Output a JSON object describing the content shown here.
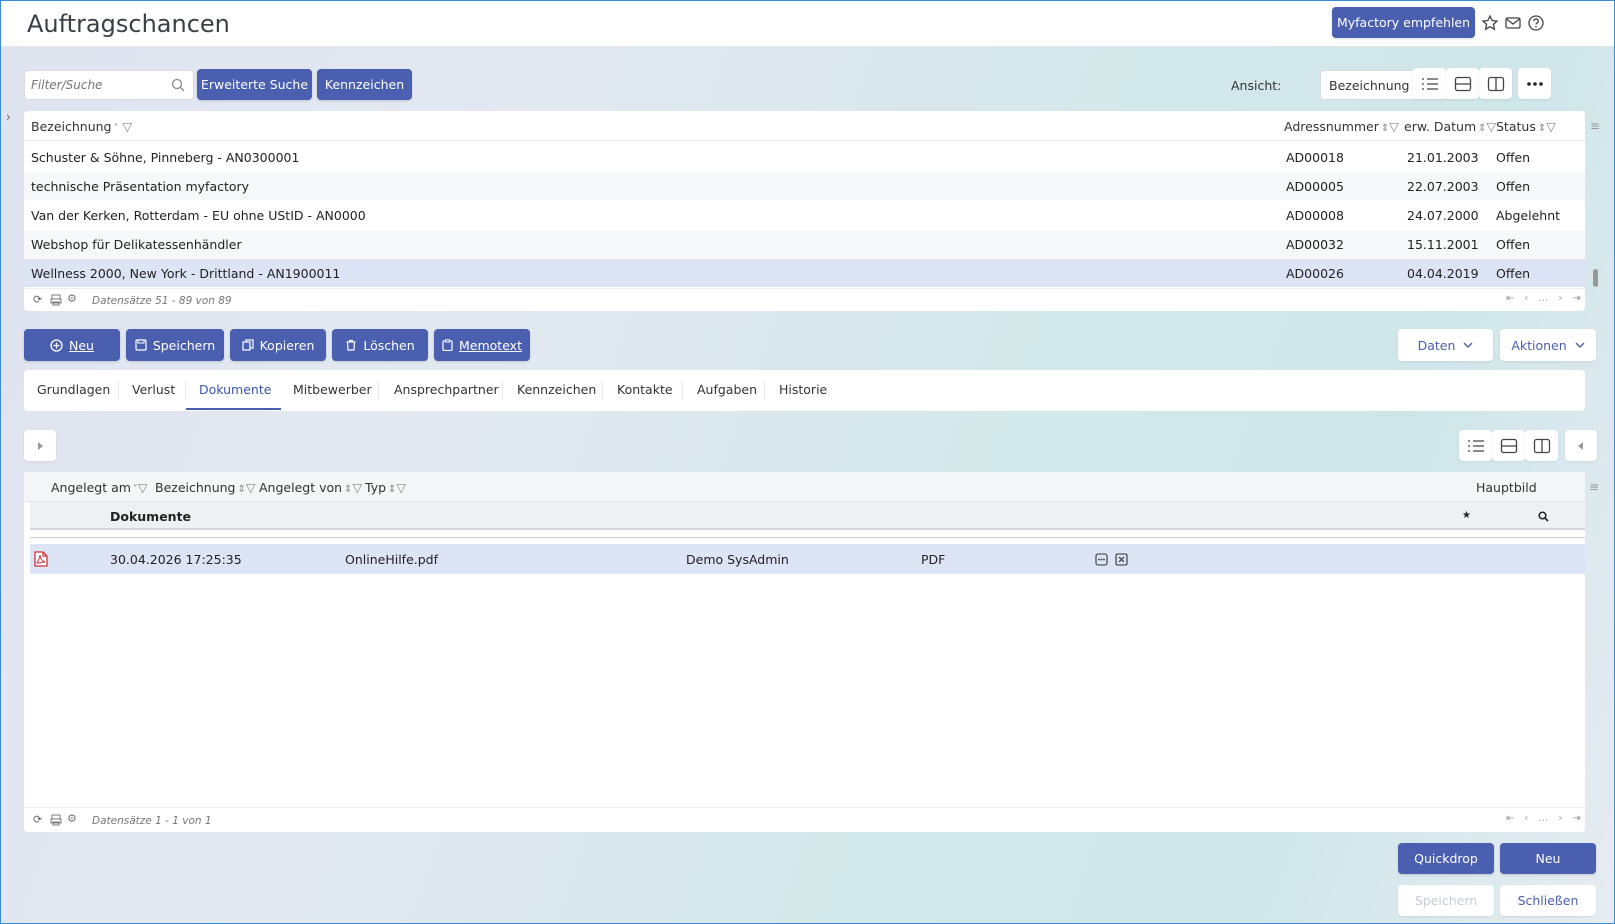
{
  "header": {
    "title": "Auftragschancen",
    "recommend_label": "Myfactory empfehlen"
  },
  "toolbar": {
    "search_placeholder": "Filter/Suche",
    "extended_search_label": "Erweiterte Suche",
    "tags_label": "Kennzeichen",
    "view_label": "Ansicht:",
    "view_value": "Bezeichnung"
  },
  "main_grid": {
    "columns": [
      "Bezeichnung",
      "Adressnummer",
      "erw. Datum",
      "Status"
    ],
    "rows": [
      {
        "bezeichnung": "Schuster & Söhne, Pinneberg - AN0300001",
        "adresse": "AD00018",
        "datum": "21.01.2003",
        "status": "Offen"
      },
      {
        "bezeichnung": "technische Präsentation myfactory",
        "adresse": "AD00005",
        "datum": "22.07.2003",
        "status": "Offen"
      },
      {
        "bezeichnung": "Van der Kerken, Rotterdam - EU ohne UStID - AN0000",
        "adresse": "AD00008",
        "datum": "24.07.2000",
        "status": "Abgelehnt"
      },
      {
        "bezeichnung": "Webshop für Delikatessenhändler",
        "adresse": "AD00032",
        "datum": "15.11.2001",
        "status": "Offen"
      },
      {
        "bezeichnung": "Wellness 2000, New York - Drittland - AN1900011",
        "adresse": "AD00026",
        "datum": "04.04.2019",
        "status": "Offen"
      }
    ],
    "footer": "Datensätze 51 - 89 von 89"
  },
  "actions": {
    "new": "Neu",
    "save": "Speichern",
    "copy": "Kopieren",
    "delete": "Löschen",
    "memo": "Memotext",
    "data": "Daten",
    "actions": "Aktionen"
  },
  "tabs": [
    "Grundlagen",
    "Verlust",
    "Dokumente",
    "Mitbewerber",
    "Ansprechpartner",
    "Kennzeichen",
    "Kontakte",
    "Aufgaben",
    "Historie"
  ],
  "doc_grid": {
    "columns": [
      "Angelegt am",
      "Bezeichnung",
      "Angelegt von",
      "Typ",
      "Hauptbild"
    ],
    "group_label": "Dokumente",
    "group_star": "★",
    "rows": [
      {
        "date": "30.04.2026 17:25:35",
        "name": "OnlineHilfe.pdf",
        "user": "Demo SysAdmin",
        "type": "PDF"
      }
    ],
    "footer": "Datensätze 1 - 1 von 1"
  },
  "bottom": {
    "quickdrop": "Quickdrop",
    "new": "Neu",
    "save": "Speichern",
    "close": "Schließen"
  },
  "colors": {
    "primary": "#4a5fb0",
    "selected_row": "#dde4f6",
    "pdf_icon": "#d0343a"
  }
}
